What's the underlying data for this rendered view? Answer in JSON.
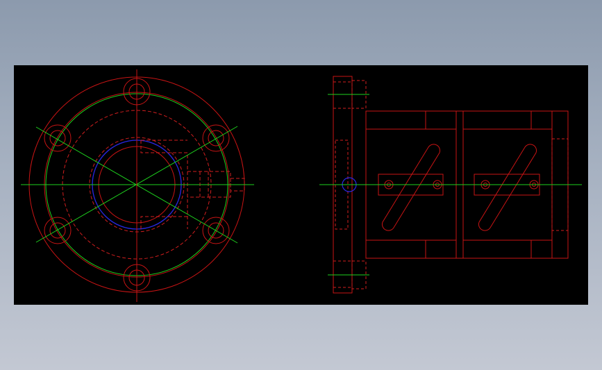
{
  "drawing": {
    "background": "#000000",
    "colors": {
      "outline": "#c81414",
      "hidden": "#d21e1e",
      "centerline": "#1ed21e",
      "highlight": "#2828e6"
    },
    "front_view": {
      "bolt_hole_count": 6,
      "flange": "circle",
      "bore": "circle"
    },
    "side_view": {
      "slot_count": 2,
      "bolt_count": 4
    }
  }
}
